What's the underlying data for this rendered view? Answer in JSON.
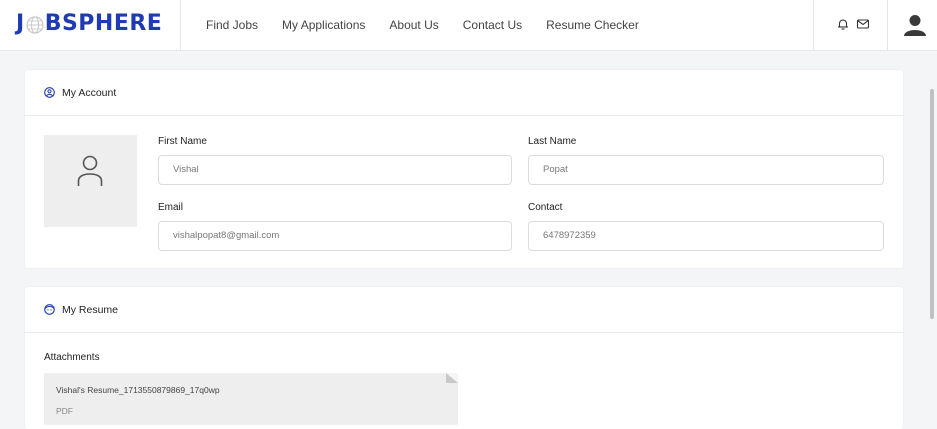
{
  "brand": {
    "logo_text_before": "J",
    "logo_text_after": "BSPHERE",
    "color": "#1f3bb3"
  },
  "nav": {
    "items": [
      "Find Jobs",
      "My Applications",
      "About Us",
      "Contact Us",
      "Resume Checker"
    ]
  },
  "header_icons": [
    "bell-icon",
    "mail-icon",
    "user-avatar-icon"
  ],
  "account": {
    "title": "My Account",
    "first_name_label": "First Name",
    "first_name_value": "Vishal",
    "last_name_label": "Last Name",
    "last_name_value": "Popat",
    "email_label": "Email",
    "email_value": "vishalpopat8@gmail.com",
    "contact_label": "Contact",
    "contact_value": "6478972359"
  },
  "resume": {
    "title": "My Resume",
    "attachments_label": "Attachments",
    "file_name": "Vishal's Resume_1713550879869_17q0wp",
    "file_type": "PDF"
  },
  "colors": {
    "accent": "#1f3bb3",
    "background": "#f4f5f7"
  }
}
